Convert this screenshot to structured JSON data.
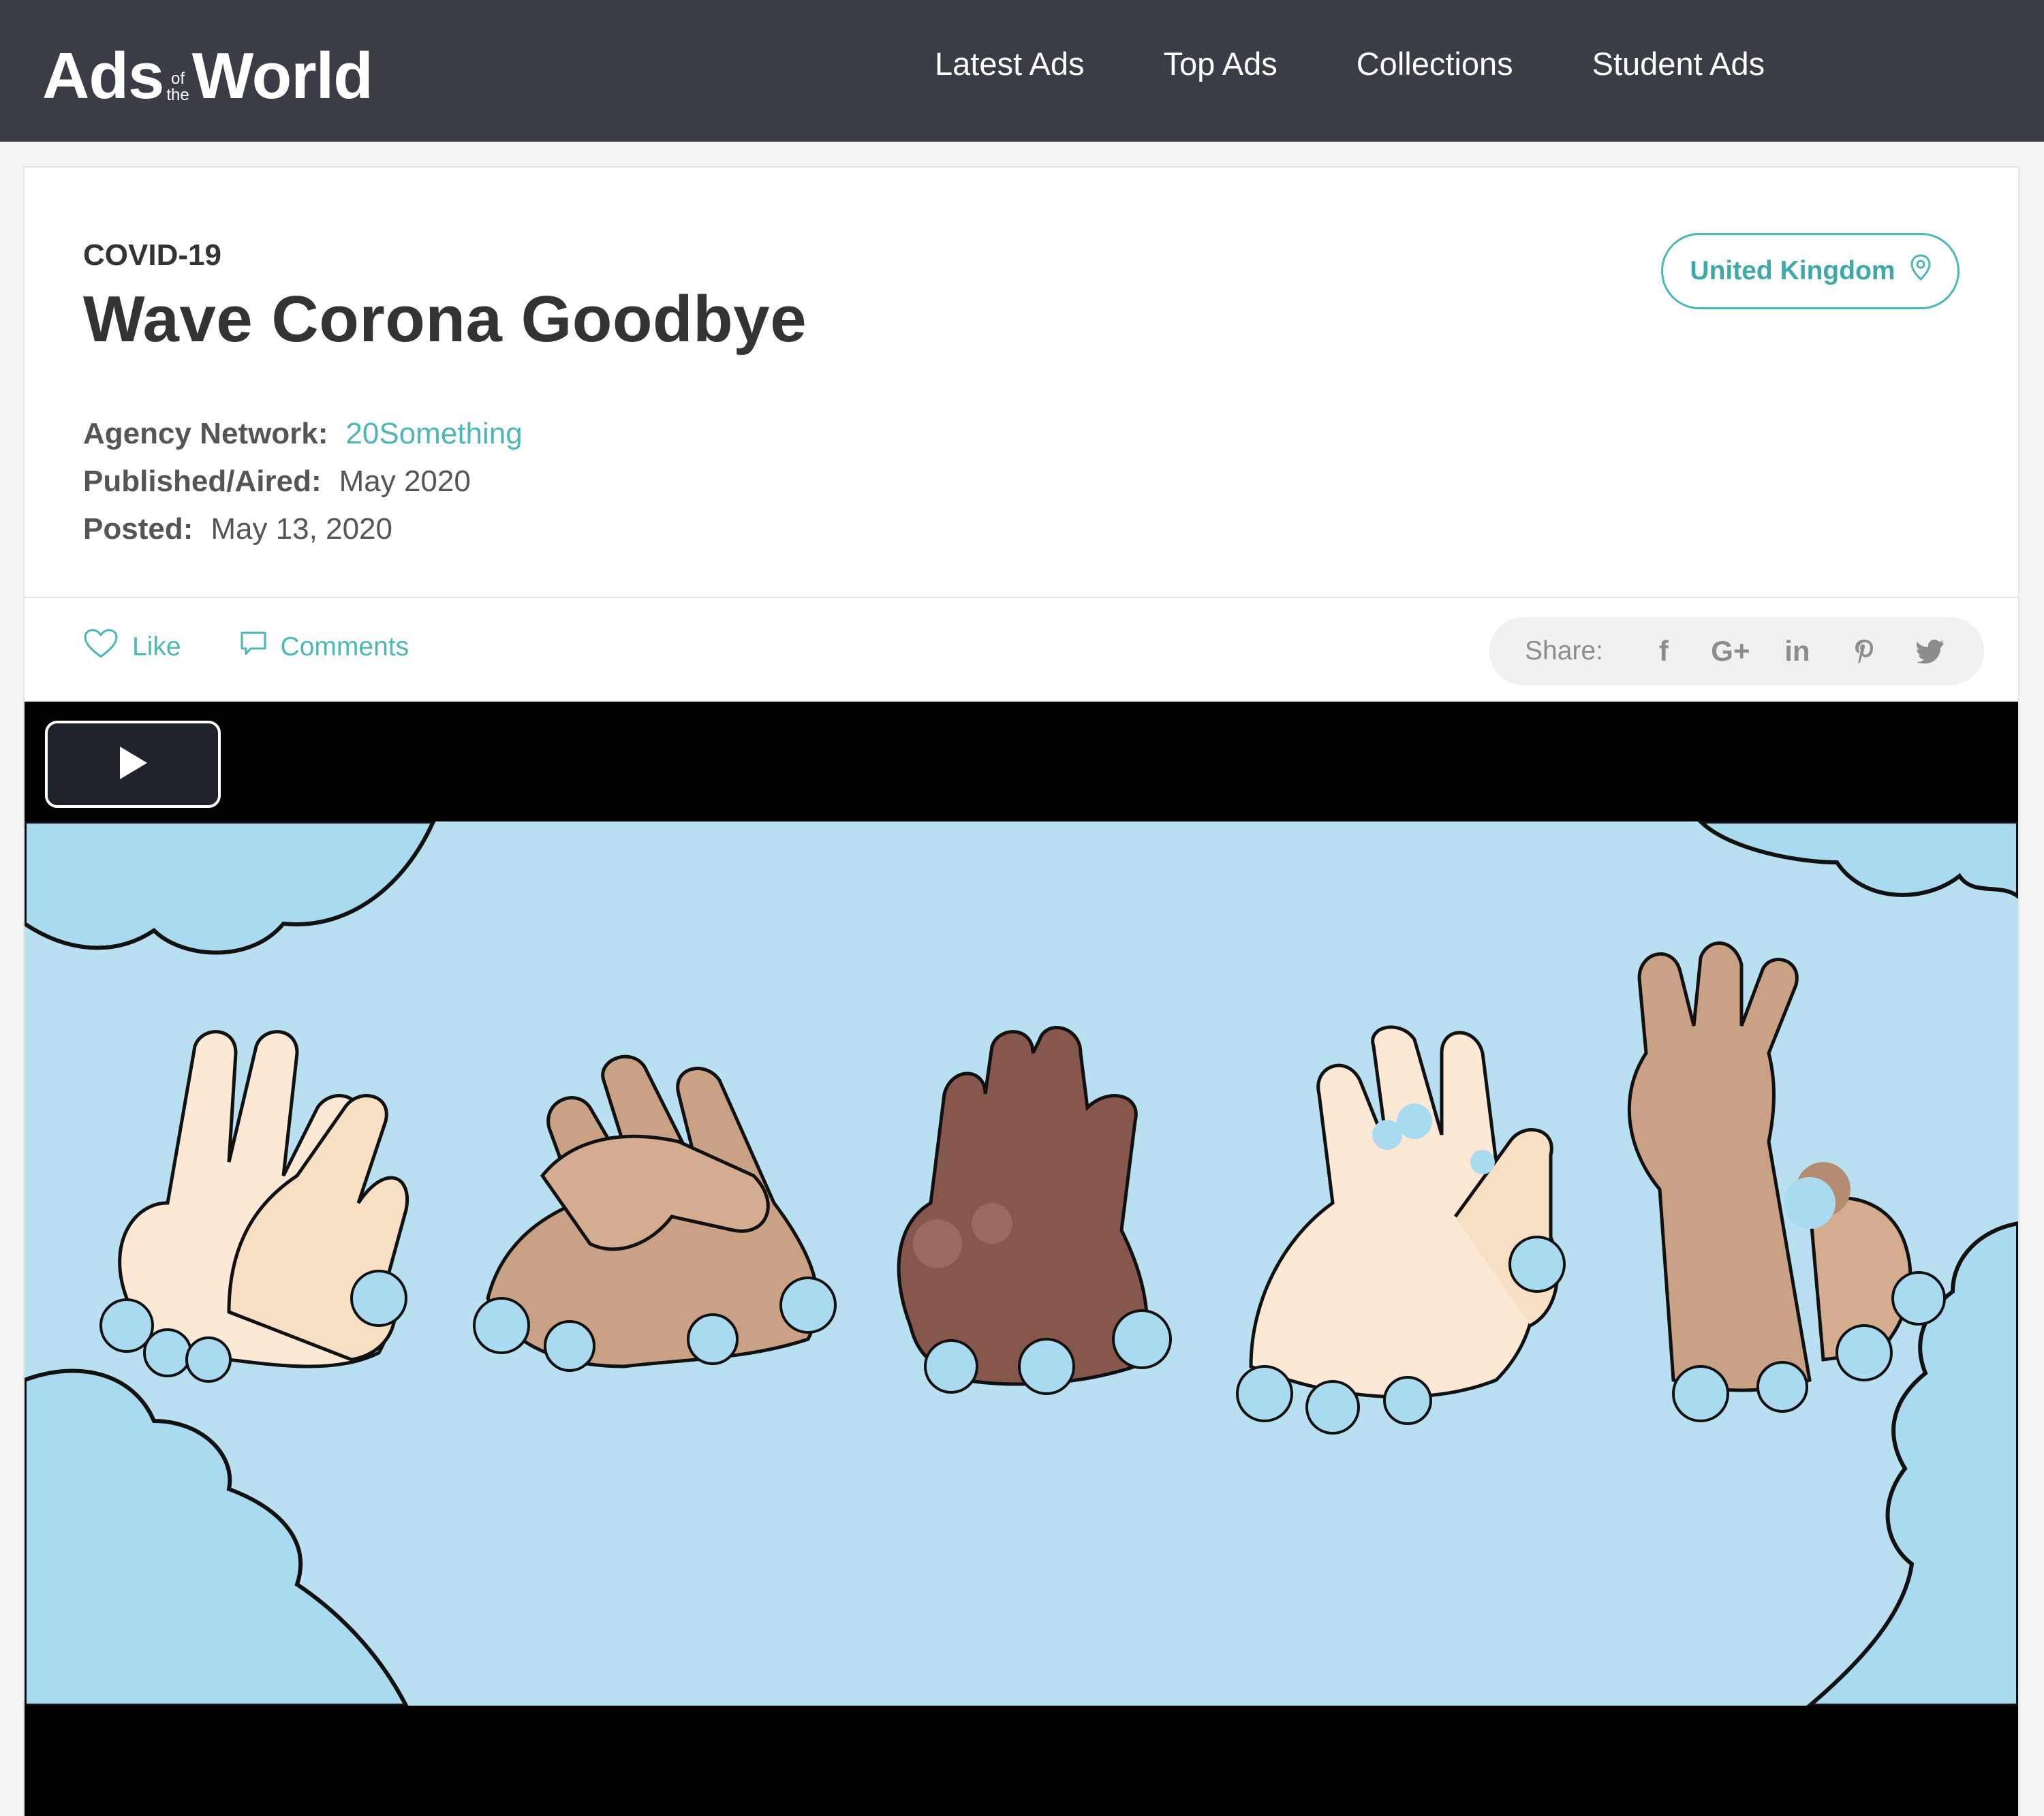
{
  "site": {
    "logo": {
      "part1": "Ads",
      "part_of": "of",
      "part_the": "the",
      "part2": "World"
    },
    "nav": [
      "Latest Ads",
      "Top Ads",
      "Collections",
      "Student Ads"
    ]
  },
  "ad": {
    "category": "COVID-19",
    "title": "Wave Corona Goodbye",
    "country": "United Kingdom",
    "meta": [
      {
        "label": "Agency Network:",
        "value": "20Something",
        "is_link": true
      },
      {
        "label": "Published/Aired:",
        "value": "May 2020",
        "is_link": false
      },
      {
        "label": "Posted:",
        "value": "May 13, 2020",
        "is_link": false
      }
    ]
  },
  "actions": {
    "like": "Like",
    "comments": "Comments"
  },
  "share": {
    "label": "Share:",
    "icons": [
      {
        "name": "facebook-icon",
        "glyph": "f"
      },
      {
        "name": "google-plus-icon",
        "glyph": "G+"
      },
      {
        "name": "linkedin-icon",
        "glyph": "in"
      },
      {
        "name": "pinterest-icon",
        "glyph": "P"
      },
      {
        "name": "twitter-icon",
        "glyph": "t"
      }
    ]
  },
  "colors": {
    "nav_bg": "#3a3d45",
    "accent": "#4bb8b6",
    "video_bg": "#000000",
    "frame_bg": "#b9e0f1",
    "soap": "#a9daf0"
  }
}
